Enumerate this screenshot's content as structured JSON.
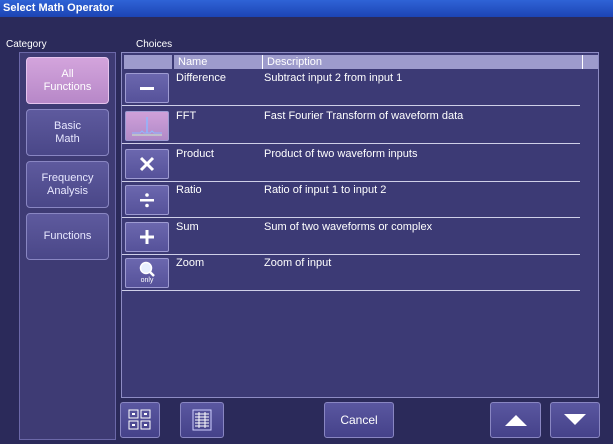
{
  "window": {
    "title": "Select Math Operator"
  },
  "labels": {
    "category": "Category",
    "choices": "Choices"
  },
  "categories": [
    {
      "label": "All\nFunctions",
      "active": true
    },
    {
      "label": "Basic\nMath",
      "active": false
    },
    {
      "label": "Frequency\nAnalysis",
      "active": false
    },
    {
      "label": "Functions",
      "active": false
    }
  ],
  "table": {
    "columns": [
      "Name",
      "Description"
    ],
    "rows": [
      {
        "icon": "minus-icon",
        "name": "Difference",
        "description": "Subtract input 2 from input 1",
        "highlighted": false
      },
      {
        "icon": "fft-spectrum-icon",
        "name": "FFT",
        "description": "Fast Fourier Transform of waveform data",
        "highlighted": true
      },
      {
        "icon": "multiply-icon",
        "name": "Product",
        "description": "Product of two waveform inputs",
        "highlighted": false
      },
      {
        "icon": "divide-icon",
        "name": "Ratio",
        "description": "Ratio of input 1 to input 2",
        "highlighted": false
      },
      {
        "icon": "plus-icon",
        "name": "Sum",
        "description": "Sum of two waveforms or complex",
        "highlighted": false
      },
      {
        "icon": "zoom-only-icon",
        "name": "Zoom",
        "description": "Zoom of input",
        "highlighted": false,
        "icon_caption": "only"
      }
    ]
  },
  "footer": {
    "cancel_label": "Cancel"
  },
  "colors": {
    "title_bar": "#2f63d6",
    "background": "#2b2a5a",
    "active_button": "#c898d4"
  }
}
